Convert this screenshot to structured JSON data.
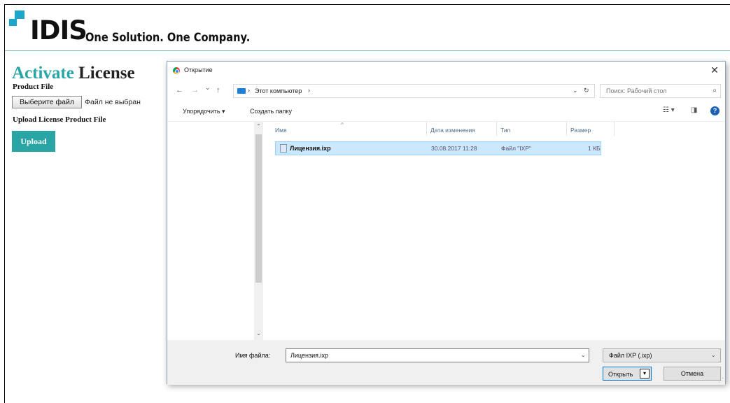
{
  "header": {
    "brand": "IDIS",
    "tagline": "One Solution. One Company."
  },
  "activate": {
    "title_accent": "Activate",
    "title_rest": " License",
    "product_file_label": "Product File",
    "choose_file_button": "Выберите файл",
    "no_file_text": "Файл не выбран",
    "upload_label": "Upload License Product File",
    "upload_button": "Upload"
  },
  "dialog": {
    "title": "Открытие",
    "close": "✕",
    "nav": {
      "back": "←",
      "forward": "→",
      "recent": "⌄",
      "up": "↑",
      "refresh": "↻"
    },
    "address": {
      "separator": "›",
      "location": "Этот компьютер",
      "trail": "›",
      "dropdown": "⌄"
    },
    "search_placeholder": "Поиск: Рабочий стол",
    "toolbar": {
      "organize": "Упорядочить ▾",
      "new_folder": "Создать папку",
      "view_menu": "☷ ▾",
      "preview_pane": "◨",
      "help": "?"
    },
    "columns": {
      "name": "Имя",
      "date": "Дата изменения",
      "type": "Тип",
      "size": "Размер",
      "sort_indicator": "^"
    },
    "files": [
      {
        "name": "Лицензия.ixp",
        "date": "30.08.2017 11:28",
        "type": "Файл \"IXP\"",
        "size": "1 КБ"
      }
    ],
    "filename_label": "Имя файла:",
    "filename_value": "Лицензия.ixp",
    "filetype": "Файл IXP (.ixp)",
    "open_button": "Открыть",
    "cancel_button": "Отмена"
  },
  "colors": {
    "accent": "#2aa5a5",
    "logo_blue": "#1aa7c9",
    "selection": "#cce8ff",
    "default_button_border": "#0078d7"
  }
}
